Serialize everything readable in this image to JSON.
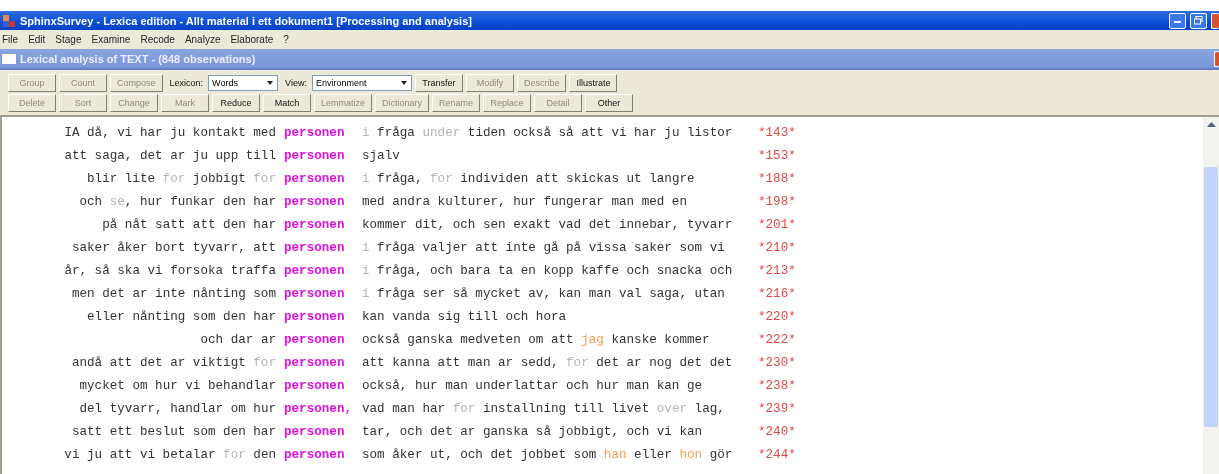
{
  "window": {
    "title": "SphinxSurvey - Lexica edition - Allt material i ett dokument1 [Processing and analysis]"
  },
  "menu": [
    {
      "label": "File"
    },
    {
      "label": "Edit"
    },
    {
      "label": "Stage"
    },
    {
      "label": "Examine"
    },
    {
      "label": "Recode"
    },
    {
      "label": "Analyze"
    },
    {
      "label": "Elaborate"
    },
    {
      "label": "?"
    }
  ],
  "document": {
    "title": "Lexical analysis of TEXT -  (848 observations)"
  },
  "toolbar_rows": [
    [
      {
        "kind": "button",
        "label": "Group",
        "disabled": true
      },
      {
        "kind": "button",
        "label": "Count",
        "disabled": true
      },
      {
        "kind": "button",
        "label": "Compose",
        "disabled": true
      },
      {
        "kind": "label",
        "label": "Lexicon:"
      },
      {
        "kind": "select",
        "value": "Words"
      },
      {
        "kind": "label",
        "label": "View:"
      },
      {
        "kind": "select",
        "value": "Environment"
      },
      {
        "kind": "button",
        "label": "Transfer",
        "disabled": false
      },
      {
        "kind": "button",
        "label": "Modify",
        "disabled": true
      },
      {
        "kind": "button",
        "label": "Describe",
        "disabled": true
      },
      {
        "kind": "button",
        "label": "Illustrate",
        "disabled": false
      }
    ],
    [
      {
        "kind": "button",
        "label": "Delete",
        "disabled": true
      },
      {
        "kind": "button",
        "label": "Sort",
        "disabled": true
      },
      {
        "kind": "button",
        "label": "Change",
        "disabled": true
      },
      {
        "kind": "button",
        "label": "Mark",
        "disabled": true
      },
      {
        "kind": "button",
        "label": "Reduce",
        "disabled": false
      },
      {
        "kind": "button",
        "label": "Match",
        "disabled": false
      },
      {
        "kind": "button",
        "label": "Lemmatize",
        "disabled": true
      },
      {
        "kind": "button",
        "label": "Dictionary",
        "disabled": true
      },
      {
        "kind": "button",
        "label": "Rename",
        "disabled": true
      },
      {
        "kind": "button",
        "label": "Replace",
        "disabled": true
      },
      {
        "kind": "button",
        "label": "Detail",
        "disabled": true
      },
      {
        "kind": "button",
        "label": "Other",
        "disabled": false
      }
    ]
  ],
  "lines": [
    {
      "left": [
        {
          "text": "IA då, vi har ju kontakt med",
          "kind": "plain"
        }
      ],
      "keyword": "personen",
      "right": [
        {
          "text": "i",
          "kind": "grey"
        },
        {
          "text": " fråga ",
          "kind": "plain"
        },
        {
          "text": "under",
          "kind": "grey"
        },
        {
          "text": " tiden också så att vi har ju listor",
          "kind": "plain"
        }
      ],
      "ref": "*143*"
    },
    {
      "left": [
        {
          "text": "att saga, det ar ju upp till",
          "kind": "plain"
        }
      ],
      "keyword": "personen",
      "right": [
        {
          "text": "sjalv",
          "kind": "plain"
        }
      ],
      "ref": "*153*"
    },
    {
      "left": [
        {
          "text": "blir lite ",
          "kind": "plain"
        },
        {
          "text": "for",
          "kind": "grey"
        },
        {
          "text": " jobbigt ",
          "kind": "plain"
        },
        {
          "text": "for",
          "kind": "grey"
        }
      ],
      "keyword": "personen",
      "right": [
        {
          "text": "i",
          "kind": "grey"
        },
        {
          "text": " fråga, ",
          "kind": "plain"
        },
        {
          "text": "for",
          "kind": "grey"
        },
        {
          "text": " individen att skickas ut langre",
          "kind": "plain"
        }
      ],
      "ref": "*188*"
    },
    {
      "left": [
        {
          "text": "och ",
          "kind": "plain"
        },
        {
          "text": "se",
          "kind": "grey"
        },
        {
          "text": ", hur funkar den har",
          "kind": "plain"
        }
      ],
      "keyword": "personen",
      "right": [
        {
          "text": "med andra kulturer, hur fungerar man med en",
          "kind": "plain"
        }
      ],
      "ref": "*198*"
    },
    {
      "left": [
        {
          "text": "på nåt satt att den har",
          "kind": "plain"
        }
      ],
      "keyword": "personen",
      "right": [
        {
          "text": "kommer dit, och sen exakt vad det innebar, tyvarr",
          "kind": "plain"
        }
      ],
      "ref": "*201*"
    },
    {
      "left": [
        {
          "text": "saker åker bort tyvarr, att",
          "kind": "plain"
        }
      ],
      "keyword": "personen",
      "right": [
        {
          "text": "i",
          "kind": "grey"
        },
        {
          "text": " fråga valjer att inte gå på vissa saker som vi",
          "kind": "plain"
        }
      ],
      "ref": "*210*"
    },
    {
      "left": [
        {
          "text": "år, så ska vi forsoka traffa",
          "kind": "plain"
        }
      ],
      "keyword": "personen",
      "right": [
        {
          "text": "i",
          "kind": "grey"
        },
        {
          "text": " fråga, och bara ta en kopp kaffe och snacka och",
          "kind": "plain"
        }
      ],
      "ref": "*213*"
    },
    {
      "left": [
        {
          "text": "men det ar inte nånting som",
          "kind": "plain"
        }
      ],
      "keyword": "personen",
      "right": [
        {
          "text": "i",
          "kind": "grey"
        },
        {
          "text": " fråga ser så mycket av, kan man val saga, utan",
          "kind": "plain"
        }
      ],
      "ref": "*216*"
    },
    {
      "left": [
        {
          "text": "eller nånting som den har",
          "kind": "plain"
        }
      ],
      "keyword": "personen",
      "right": [
        {
          "text": "kan vanda sig till och hora",
          "kind": "plain"
        }
      ],
      "ref": "*220*"
    },
    {
      "left": [
        {
          "text": "och dar ar",
          "kind": "plain"
        }
      ],
      "keyword": "personen",
      "right": [
        {
          "text": "också ganska medveten om att ",
          "kind": "plain"
        },
        {
          "text": "jag",
          "kind": "orange"
        },
        {
          "text": " kanske kommer",
          "kind": "plain"
        }
      ],
      "ref": "*222*"
    },
    {
      "left": [
        {
          "text": "andå att det ar viktigt ",
          "kind": "plain"
        },
        {
          "text": "for",
          "kind": "grey"
        }
      ],
      "keyword": "personen",
      "right": [
        {
          "text": "att kanna att man ar sedd, ",
          "kind": "plain"
        },
        {
          "text": "for",
          "kind": "grey"
        },
        {
          "text": " det ar nog det det",
          "kind": "plain"
        }
      ],
      "ref": "*230*"
    },
    {
      "left": [
        {
          "text": "mycket om hur vi behandlar",
          "kind": "plain"
        }
      ],
      "keyword": "personen",
      "right": [
        {
          "text": "också, hur man underlattar och hur man kan ge",
          "kind": "plain"
        }
      ],
      "ref": "*238*"
    },
    {
      "left": [
        {
          "text": "del tyvarr, handlar om hur",
          "kind": "plain"
        }
      ],
      "keyword": "personen,",
      "right": [
        {
          "text": "vad man har ",
          "kind": "plain"
        },
        {
          "text": "for",
          "kind": "grey"
        },
        {
          "text": " installning till livet ",
          "kind": "plain"
        },
        {
          "text": "over",
          "kind": "grey"
        },
        {
          "text": " lag,",
          "kind": "plain"
        }
      ],
      "ref": "*239*"
    },
    {
      "left": [
        {
          "text": "satt ett beslut som den har",
          "kind": "plain"
        }
      ],
      "keyword": "personen",
      "right": [
        {
          "text": "tar, och det ar ganska så jobbigt, och vi kan",
          "kind": "plain"
        }
      ],
      "ref": "*240*"
    },
    {
      "left": [
        {
          "text": "vi ju att vi betalar ",
          "kind": "plain"
        },
        {
          "text": "for",
          "kind": "grey"
        },
        {
          "text": " den",
          "kind": "plain"
        }
      ],
      "keyword": "personen",
      "right": [
        {
          "text": "som åker ut, och det jobbet som ",
          "kind": "plain"
        },
        {
          "text": "han",
          "kind": "orange"
        },
        {
          "text": " eller ",
          "kind": "plain"
        },
        {
          "text": "hon",
          "kind": "orange"
        },
        {
          "text": " gör",
          "kind": "plain"
        }
      ],
      "ref": "*244*"
    }
  ]
}
